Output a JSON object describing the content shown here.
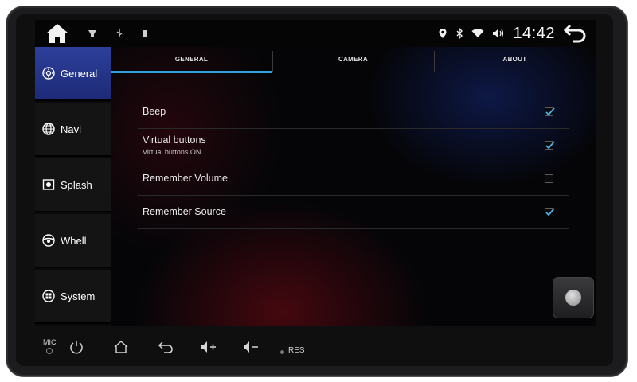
{
  "status_bar": {
    "time": "14:42",
    "icons": [
      "home-icon",
      "notification-icon",
      "usb-icon",
      "sd-card-icon",
      "location-icon",
      "bluetooth-icon",
      "wifi-icon",
      "volume-icon",
      "back-icon"
    ]
  },
  "sidebar": {
    "items": [
      {
        "label": "General",
        "icon": "gear-icon",
        "active": true
      },
      {
        "label": "Navi",
        "icon": "globe-icon",
        "active": false
      },
      {
        "label": "Splash",
        "icon": "image-icon",
        "active": false
      },
      {
        "label": "Whell",
        "icon": "steering-wheel-icon",
        "active": false
      },
      {
        "label": "System",
        "icon": "system-icon",
        "active": false
      }
    ]
  },
  "tabs": [
    {
      "label": "GENERAL",
      "active": true
    },
    {
      "label": "CAMERA",
      "active": false
    },
    {
      "label": "ABOUT",
      "active": false
    }
  ],
  "settings": [
    {
      "title": "Beep",
      "subtitle": "",
      "checked": true
    },
    {
      "title": "Virtual buttons",
      "subtitle": "Virtual buttons ON",
      "checked": true
    },
    {
      "title": "Remember Volume",
      "subtitle": "",
      "checked": false
    },
    {
      "title": "Remember Source",
      "subtitle": "",
      "checked": true
    }
  ],
  "hardware": {
    "mic_label": "MIC",
    "res_label": "RES",
    "buttons": [
      "power-icon",
      "home-outline-icon",
      "back-arrow-icon",
      "volume-up-icon",
      "volume-down-icon"
    ]
  },
  "colors": {
    "accent": "#2ea3e0",
    "active_sidebar": "#2d3f9a",
    "checkbox_check": "#4fb3e8"
  }
}
